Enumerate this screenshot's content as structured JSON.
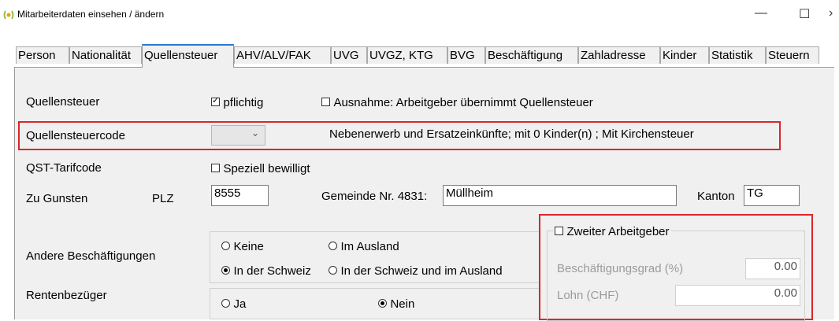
{
  "window": {
    "title": "Mitarbeiterdaten einsehen / ändern",
    "minimize_glyph": "—",
    "maximize_glyph": "☐",
    "close_glyph": "›"
  },
  "tabs": [
    {
      "label": "Person"
    },
    {
      "label": "Nationalität"
    },
    {
      "label": "Quellensteuer",
      "active": true
    },
    {
      "label": "AHV/ALV/FAK"
    },
    {
      "label": "UVG"
    },
    {
      "label": "UVGZ, KTG"
    },
    {
      "label": "BVG"
    },
    {
      "label": "Beschäftigung"
    },
    {
      "label": "Zahladresse"
    },
    {
      "label": "Kinder"
    },
    {
      "label": "Statistik"
    },
    {
      "label": "Steuern"
    }
  ],
  "form": {
    "quellensteuer_label": "Quellensteuer",
    "pflichtig_label": "pflichtig",
    "pflichtig_checked": true,
    "ausnahme_label": "Ausnahme: Arbeitgeber übernimmt Quellensteuer",
    "ausnahme_checked": false,
    "code_label": "Quellensteuercode",
    "code_value": "",
    "code_description": "Nebenerwerb und Ersatzeinkünfte; mit 0 Kinder(n) ; Mit Kirchensteuer",
    "tarifcode_label": "QST-Tarifcode",
    "speziell_label": "Speziell bewilligt",
    "speziell_checked": false,
    "zugunsten_label": "Zu Gunsten",
    "plz_label": "PLZ",
    "plz_value": "8555",
    "gemeinde_label": "Gemeinde Nr. 4831:",
    "gemeinde_value": "Müllheim",
    "kanton_label": "Kanton",
    "kanton_value": "TG",
    "andere_label": "Andere Beschäftigungen",
    "andere_options": [
      "Keine",
      "Im Ausland",
      "In der Schweiz",
      "In der Schweiz und im Ausland"
    ],
    "andere_selected": "In der Schweiz",
    "renten_label": "Rentenbezüger",
    "renten_options": [
      "Ja",
      "Nein"
    ],
    "renten_selected": "Nein"
  },
  "zweiter": {
    "label": "Zweiter Arbeitgeber",
    "checked": false,
    "grad_label": "Beschäftigungsgrad (%)",
    "grad_value": "0.00",
    "lohn_label": "Lohn (CHF)",
    "lohn_value": "0.00"
  },
  "colors": {
    "highlight_red": "#d9262b",
    "tab_accent": "#2b79d8",
    "panel_bg": "#f0f0f0",
    "app_icon_green": "#8cc63f"
  }
}
